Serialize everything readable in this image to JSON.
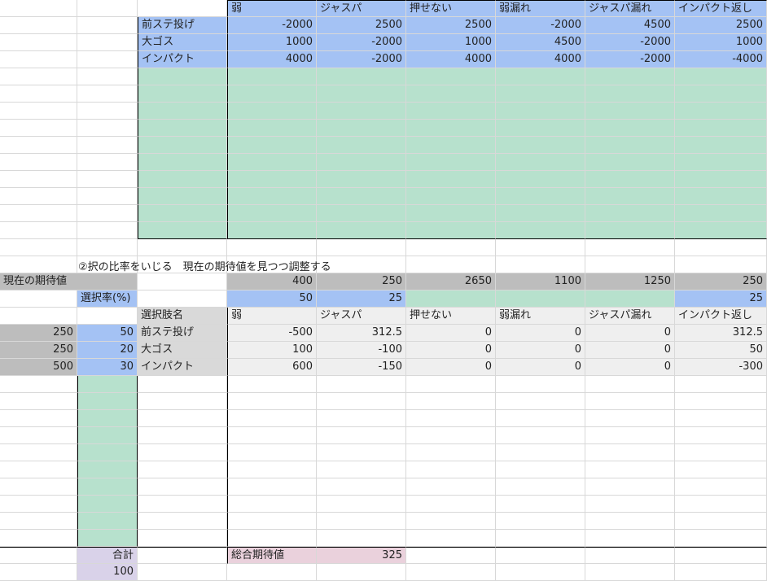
{
  "top_table": {
    "headers": [
      "弱",
      "ジャスパ",
      "押せない",
      "弱漏れ",
      "ジャスパ漏れ",
      "インパクト返し"
    ],
    "rows": [
      {
        "label": "前ステ投げ",
        "values": [
          "-2000",
          "2500",
          "2500",
          "-2000",
          "4500",
          "2500"
        ]
      },
      {
        "label": "大ゴス",
        "values": [
          "1000",
          "-2000",
          "1000",
          "4500",
          "-2000",
          "1000"
        ]
      },
      {
        "label": "インパクト",
        "values": [
          "4000",
          "-2000",
          "4000",
          "4000",
          "-2000",
          "-4000"
        ]
      }
    ]
  },
  "note": "②択の比率をいじる　現在の期待値を見つつ調整する",
  "expected": {
    "label": "現在の期待値",
    "values": [
      "400",
      "250",
      "2650",
      "1100",
      "1250",
      "250"
    ]
  },
  "selection_rate": {
    "label": "選択率(%)",
    "values": [
      "50",
      "25",
      "",
      "",
      "",
      "25"
    ]
  },
  "bottom_table": {
    "col_label": "選択肢名",
    "headers": [
      "弱",
      "ジャスパ",
      "押せない",
      "弱漏れ",
      "ジャスパ漏れ",
      "インパクト返し"
    ],
    "rows": [
      {
        "ev": "250",
        "rate": "50",
        "label": "前ステ投げ",
        "values": [
          "-500",
          "312.5",
          "0",
          "0",
          "0",
          "312.5"
        ]
      },
      {
        "ev": "250",
        "rate": "20",
        "label": "大ゴス",
        "values": [
          "100",
          "-100",
          "0",
          "0",
          "0",
          "50"
        ]
      },
      {
        "ev": "500",
        "rate": "30",
        "label": "インパクト",
        "values": [
          "600",
          "-150",
          "0",
          "0",
          "0",
          "-300"
        ]
      }
    ]
  },
  "totals": {
    "sum_label": "合計",
    "sum_value": "100",
    "overall_label": "総合期待値",
    "overall_value": "325"
  },
  "colors": {
    "blue": "#a4c2f4",
    "green": "#b7e1cd",
    "gray": "#bdbdbd",
    "purple": "#d9d2e9",
    "pink": "#ead1dc"
  }
}
